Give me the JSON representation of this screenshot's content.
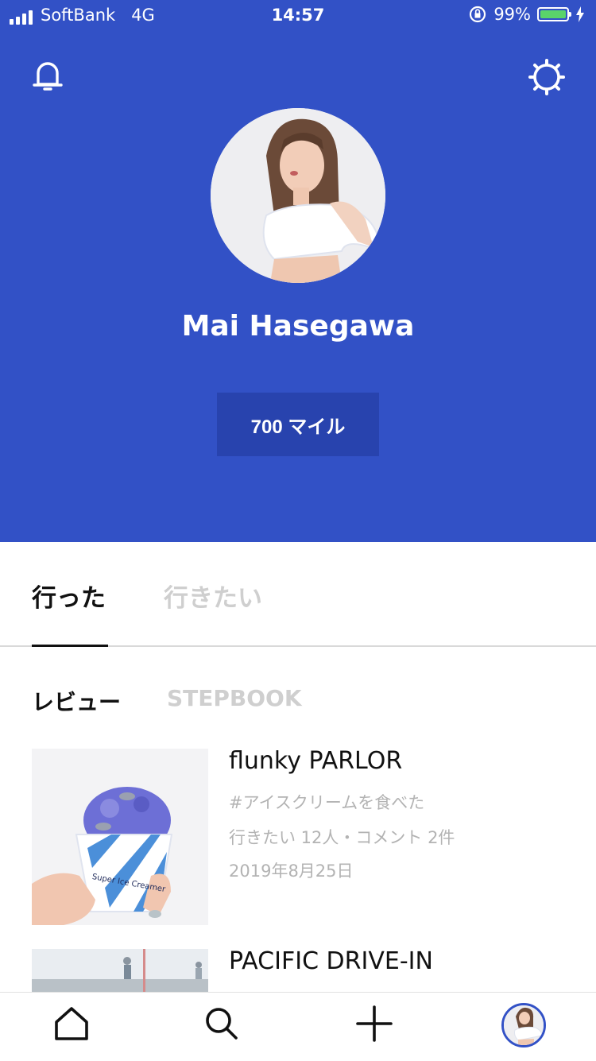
{
  "status_bar": {
    "carrier": "SoftBank",
    "network": "4G",
    "time": "14:57",
    "battery": "99%"
  },
  "icons": {
    "notifications": "bell-icon",
    "settings": "gear-icon"
  },
  "profile": {
    "name": "Mai Hasegawa",
    "miles_label": "700 マイル"
  },
  "tabs": [
    {
      "label": "行った",
      "selected": true
    },
    {
      "label": "行きたい",
      "selected": false
    }
  ],
  "subtabs": [
    {
      "label": "レビュー",
      "selected": true
    },
    {
      "label": "STEPBOOK",
      "selected": false
    }
  ],
  "reviews": [
    {
      "title": "flunky PARLOR",
      "tag": "#アイスクリームを食べた",
      "stats": "行きたい 12人・コメント 2件",
      "date": "2019年8月25日",
      "cup_text": "Super Ice Creamer"
    },
    {
      "title": "PACIFIC DRIVE-IN"
    }
  ],
  "bottom_nav": [
    {
      "name": "home",
      "icon": "home-icon"
    },
    {
      "name": "search",
      "icon": "search-icon"
    },
    {
      "name": "add",
      "icon": "plus-icon"
    },
    {
      "name": "profile",
      "icon": "avatar"
    }
  ],
  "colors": {
    "brand_blue": "#3251c6",
    "button_blue": "#2843ae",
    "muted_text": "#b3b3b3"
  }
}
